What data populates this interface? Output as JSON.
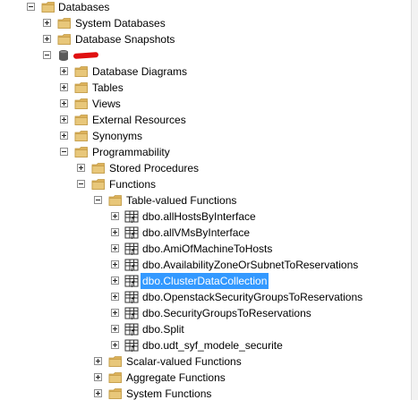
{
  "tree": {
    "databases": "Databases",
    "system_databases": "System Databases",
    "database_snapshots": "Database Snapshots",
    "database_name": "",
    "database_diagrams": "Database Diagrams",
    "tables": "Tables",
    "views": "Views",
    "external_resources": "External Resources",
    "synonyms": "Synonyms",
    "programmability": "Programmability",
    "stored_procedures": "Stored Procedures",
    "functions": "Functions",
    "table_valued_functions": "Table-valued Functions",
    "tvf_items": [
      "dbo.allHostsByInterface",
      "dbo.allVMsByInterface",
      "dbo.AmiOfMachineToHosts",
      "dbo.AvailabilityZoneOrSubnetToReservations",
      "dbo.ClusterDataCollection",
      "dbo.OpenstackSecurityGroupsToReservations",
      "dbo.SecurityGroupsToReservations",
      "dbo.Split",
      "dbo.udt_syf_modele_securite"
    ],
    "selected_item": "dbo.ClusterDataCollection",
    "scalar_valued_functions": "Scalar-valued Functions",
    "aggregate_functions": "Aggregate Functions",
    "system_functions": "System Functions"
  },
  "colors": {
    "selection": "#3399ff",
    "folder": "#dcb15a",
    "redaction": "#e01010"
  },
  "icons": {
    "folder": "folder-icon",
    "database": "database-icon",
    "function": "table-function-icon",
    "expand": "plus-icon",
    "collapse": "minus-icon"
  }
}
